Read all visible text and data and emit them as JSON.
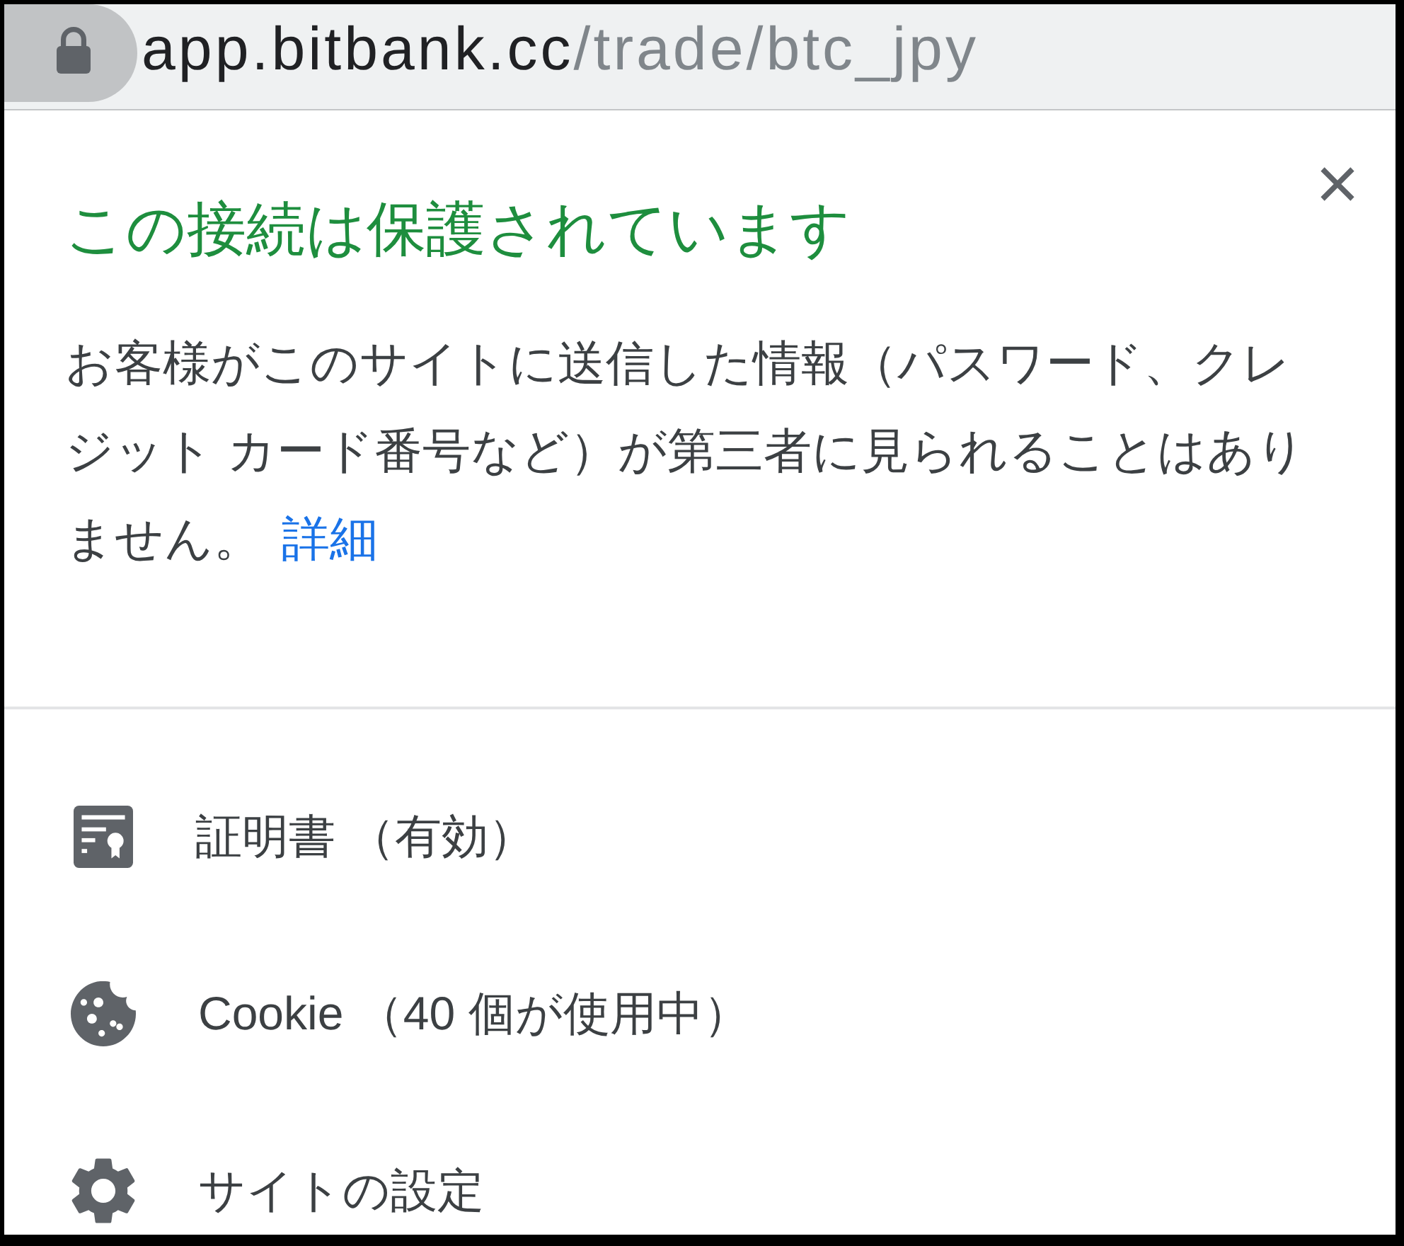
{
  "address_bar": {
    "host": "app.bitbank.cc",
    "path": "/trade/btc_jpy"
  },
  "popup": {
    "title": "この接続は保護されています",
    "description": "お客様がこのサイトに送信した情報（パスワード、クレジット カード番号など）が第三者に見られることはありません。",
    "link": "詳細"
  },
  "items": [
    {
      "kind": "certificate",
      "label": "証明書 （有効）"
    },
    {
      "kind": "cookies",
      "label": "Cookie （40 個が使用中）"
    },
    {
      "kind": "settings",
      "label": "サイトの設定"
    }
  ]
}
